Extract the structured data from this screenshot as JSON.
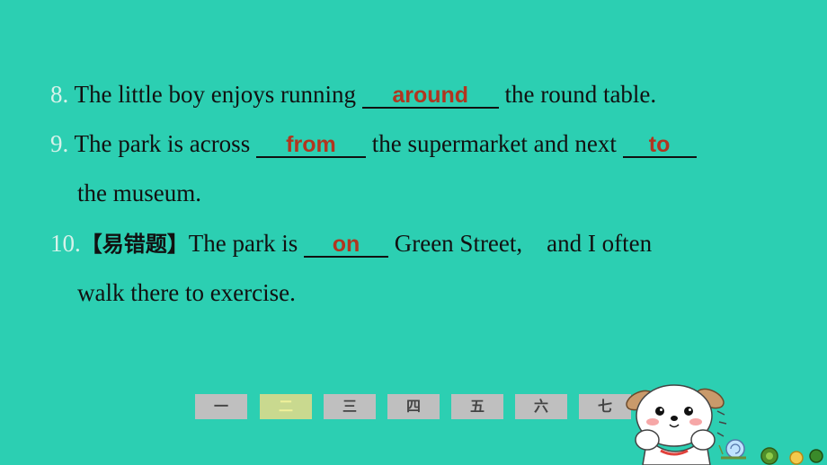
{
  "questions": [
    {
      "num": "8.",
      "text_before": "The little boy enjoys running",
      "answer": "around",
      "text_after": "the round table."
    },
    {
      "num": "9.",
      "text_before": "The park is across",
      "answer1": "from",
      "text_middle": "the supermarket and next",
      "answer2": "to",
      "continuation": "the museum."
    },
    {
      "num": "10.",
      "tag": "【易错题】",
      "text_before": "The park is",
      "answer": "on",
      "text_after": "Green Street,",
      "text_after2": "and I often",
      "continuation": "walk there to exercise."
    }
  ],
  "nav": {
    "items": [
      "一",
      "二",
      "三",
      "四",
      "五",
      "六",
      "七"
    ],
    "active_index": 1
  },
  "colors": {
    "background": "#2ccfb2",
    "answer": "#b2351f",
    "nav_button": "#bfbfbf",
    "nav_active": "#c9d98f"
  },
  "decor": {
    "mascot": "puppy-mascot-icon",
    "snail": "snail-icon"
  }
}
